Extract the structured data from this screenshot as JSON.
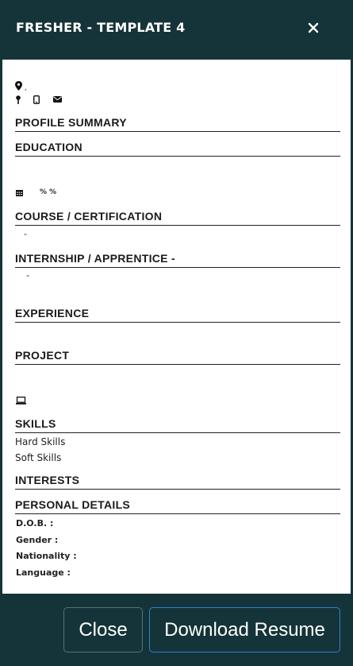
{
  "modal": {
    "title": "FRESHER - TEMPLATE 4",
    "close_icon": "close-icon"
  },
  "contact": {
    "address_separator": ",",
    "icons": [
      "location-icon",
      "location-pin-icon",
      "mobile-icon",
      "envelope-icon"
    ]
  },
  "sections": {
    "profile_summary": "PROFILE SUMMARY",
    "education": "EDUCATION",
    "course": "COURSE / CERTIFICATION",
    "internship": "INTERNSHIP / APPRENTICE -",
    "experience": "EXPERIENCE",
    "project": "PROJECT",
    "skills": "SKILLS",
    "interests": "INTERESTS",
    "personal": "PERSONAL DETAILS"
  },
  "education": {
    "percent": "% %",
    "icon": "calendar-icon"
  },
  "course": {
    "dash": "-"
  },
  "internship": {
    "dash": "-"
  },
  "project": {
    "icon": "laptop-icon"
  },
  "skills": {
    "hard": "Hard Skills",
    "soft": "Soft Skills"
  },
  "personal": {
    "dob": "D.O.B. :",
    "gender": "Gender :",
    "nationality": "Nationality :",
    "language": "Language :"
  },
  "footer": {
    "close_label": "Close",
    "download_label": "Download Resume"
  },
  "colors": {
    "header_bg": "#153439",
    "download_border": "#2e7fd6"
  }
}
